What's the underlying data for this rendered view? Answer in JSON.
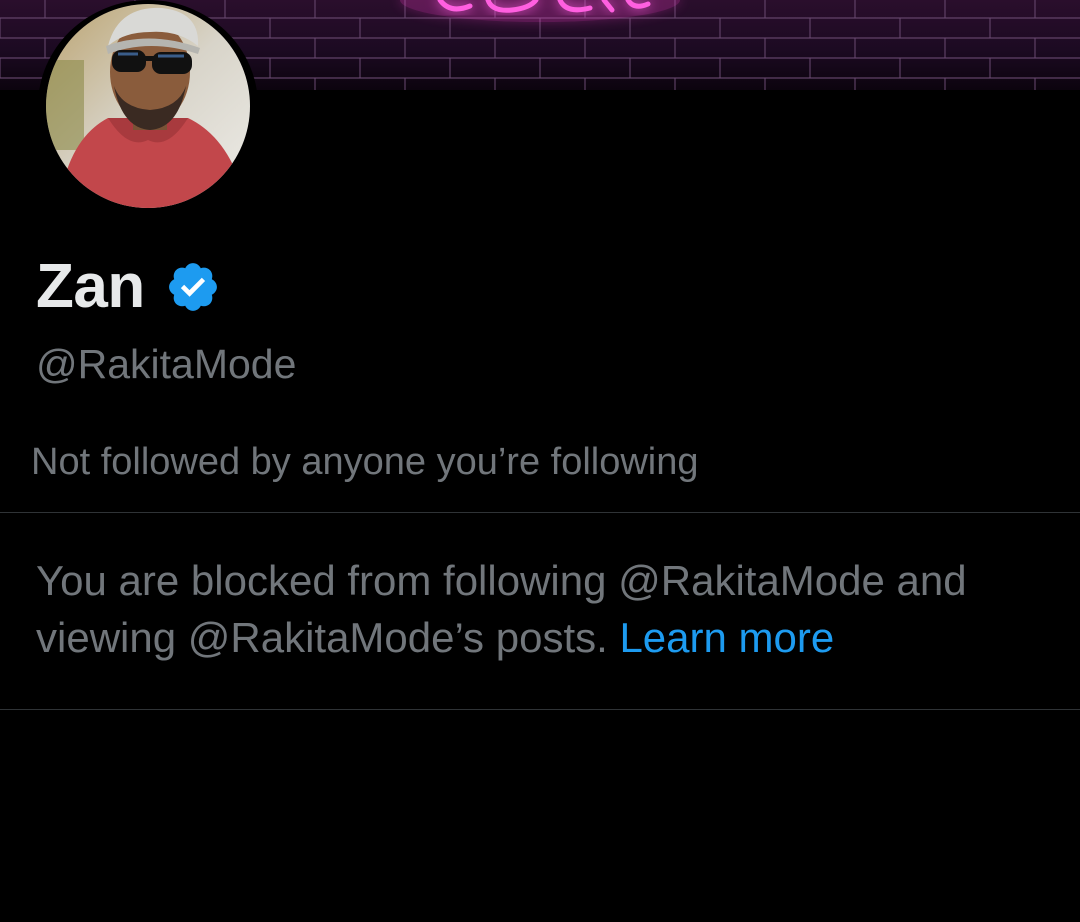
{
  "profile": {
    "display_name": "Zan",
    "handle": "@RakitaMode",
    "verified_icon": "verified-badge-icon",
    "followed_by": "Not followed by anyone you’re following"
  },
  "blocked_notice": {
    "line1": "You are blocked from following @RakitaMode and",
    "line2": "viewing @RakitaMode’s posts.",
    "link_label": "Learn more"
  },
  "colors": {
    "background": "#000000",
    "primary_text": "#e7e9ea",
    "secondary_text": "#71767b",
    "link": "#1d9bf0",
    "divider": "#2f3336",
    "verified": "#1d9bf0",
    "banner_neon": "#ff3fd0"
  }
}
